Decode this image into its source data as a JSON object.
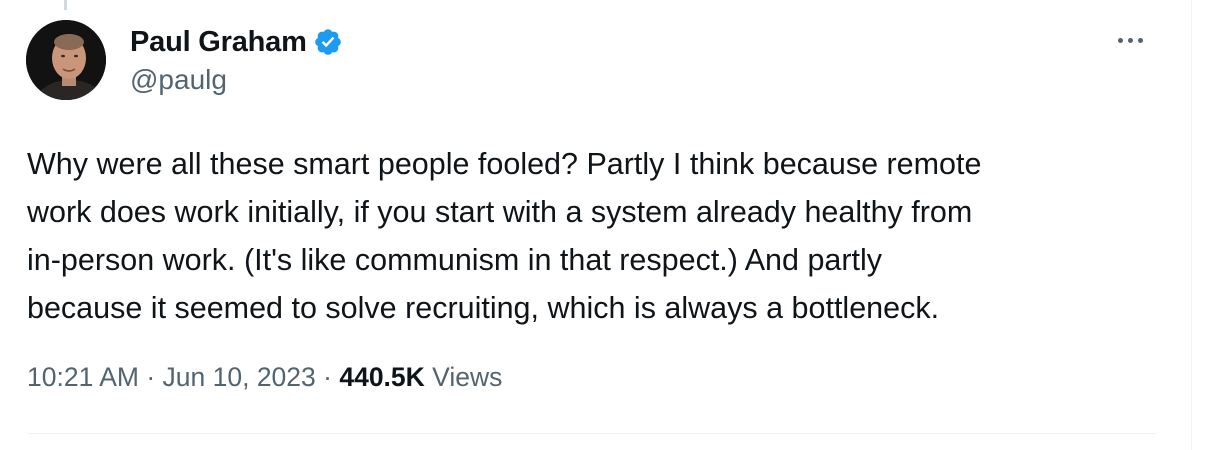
{
  "author": {
    "display_name": "Paul Graham",
    "handle": "@paulg",
    "verified": true,
    "avatar_icon": "profile-photo"
  },
  "tweet": {
    "lines": [
      "Why were all these smart people fooled? Partly I think because remote",
      "work does work initially, if you start with a system already healthy from",
      "in-person work. (It's like communism in that respect.) And partly",
      "because it seemed to solve recruiting, which is always a bottleneck."
    ]
  },
  "meta": {
    "time": "10:21 AM",
    "separator": " · ",
    "date": "Jun 10, 2023",
    "views_count": "440.5K",
    "views_label": " Views"
  },
  "icons": {
    "verified": "verified-badge-icon",
    "more": "more-options-icon"
  },
  "colors": {
    "verified_blue": "#1d9bf0",
    "text_primary": "#0f1419",
    "text_secondary": "#536471"
  }
}
